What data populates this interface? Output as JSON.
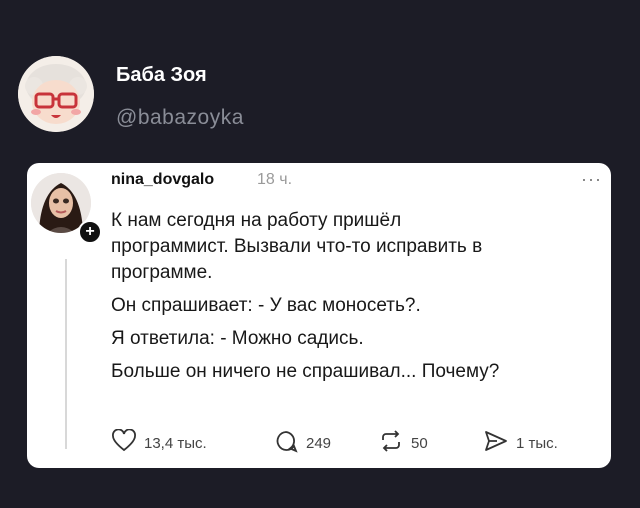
{
  "author": {
    "name": "Баба Зоя",
    "handle": "@babazoyka",
    "avatar_icon": "grandma-avatar-icon"
  },
  "post": {
    "username": "nina_dovgalo",
    "time": "18 ч.",
    "more_icon": "more-dots-icon",
    "lines": [
      "К нам сегодня на работу пришёл",
      "программист. Вызвали что-то исправить в",
      "программе.",
      "Он спрашивает: - У вас моносеть?.",
      "Я ответила: - Можно садись.",
      "Больше он ничего не спрашивал... Почему?"
    ],
    "actions": {
      "likes": "13,4 тыс.",
      "comments": "249",
      "reposts": "50",
      "shares": "1 тыс."
    }
  },
  "colors": {
    "background": "#1c1c26",
    "card": "#ffffff",
    "handle": "#8a8d97"
  }
}
